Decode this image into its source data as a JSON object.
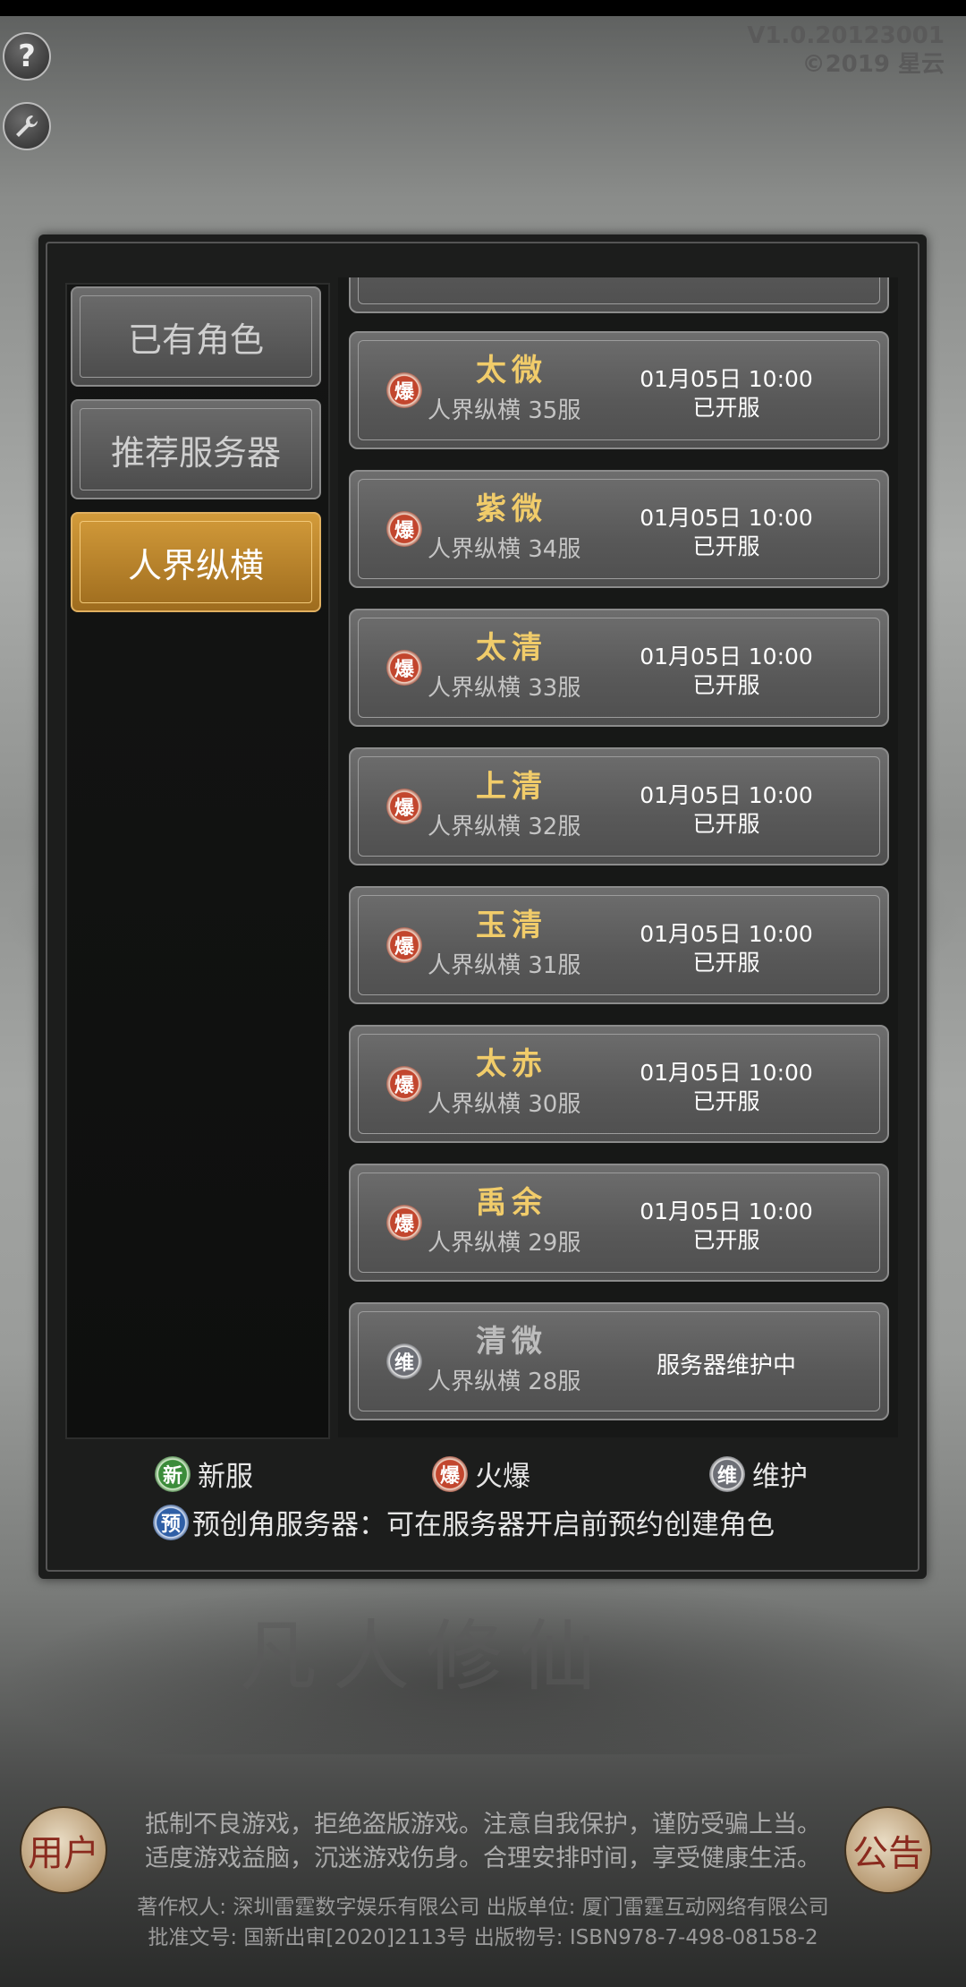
{
  "version": {
    "line1": "V1.0.20123001",
    "line2": "©2019 星云"
  },
  "icons": {
    "help": "question-icon",
    "tool": "wrench-icon"
  },
  "tabs": [
    {
      "label": "已有角色",
      "active": false
    },
    {
      "label": "推荐服务器",
      "active": false
    },
    {
      "label": "人界纵横",
      "active": true
    }
  ],
  "servers": [
    {
      "name": "太微",
      "zone": "人界纵横 35服",
      "time": "01月05日 10:00",
      "status": "已开服",
      "badge": "爆",
      "type": "hot"
    },
    {
      "name": "紫微",
      "zone": "人界纵横 34服",
      "time": "01月05日 10:00",
      "status": "已开服",
      "badge": "爆",
      "type": "hot"
    },
    {
      "name": "太清",
      "zone": "人界纵横 33服",
      "time": "01月05日 10:00",
      "status": "已开服",
      "badge": "爆",
      "type": "hot"
    },
    {
      "name": "上清",
      "zone": "人界纵横 32服",
      "time": "01月05日 10:00",
      "status": "已开服",
      "badge": "爆",
      "type": "hot"
    },
    {
      "name": "玉清",
      "zone": "人界纵横 31服",
      "time": "01月05日 10:00",
      "status": "已开服",
      "badge": "爆",
      "type": "hot"
    },
    {
      "name": "太赤",
      "zone": "人界纵横 30服",
      "time": "01月05日 10:00",
      "status": "已开服",
      "badge": "爆",
      "type": "hot"
    },
    {
      "name": "禹余",
      "zone": "人界纵横 29服",
      "time": "01月05日 10:00",
      "status": "已开服",
      "badge": "爆",
      "type": "hot"
    },
    {
      "name": "清微",
      "zone": "人界纵横 28服",
      "time": "",
      "status": "服务器维护中",
      "badge": "维",
      "type": "maint"
    }
  ],
  "legend": {
    "new": {
      "badge": "新",
      "label": "新服"
    },
    "hot": {
      "badge": "爆",
      "label": "火爆"
    },
    "maint": {
      "badge": "维",
      "label": "维护"
    },
    "pre": {
      "badge": "预",
      "label": "预创角服务器：可在服务器开启前预约创建角色"
    }
  },
  "footer": {
    "line1": "抵制不良游戏，拒绝盗版游戏。注意自我保护，谨防受骗上当。",
    "line2": "适度游戏益脑，沉迷游戏伤身。合理安排时间，享受健康生活。",
    "line3": "著作权人: 深圳雷霆数字娱乐有限公司 出版单位: 厦门雷霆互动网络有限公司",
    "line4": "批准文号: 国新出审[2020]2113号 出版物号: ISBN978-7-498-08158-2"
  },
  "side_buttons": {
    "user": "用户",
    "notice": "公告"
  }
}
